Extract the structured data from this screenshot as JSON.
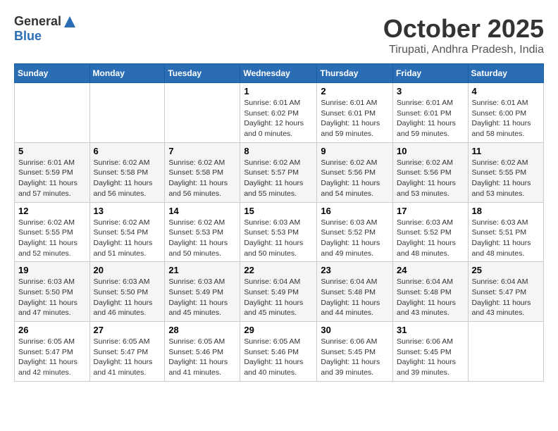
{
  "logo": {
    "general": "General",
    "blue": "Blue"
  },
  "header": {
    "month": "October 2025",
    "location": "Tirupati, Andhra Pradesh, India"
  },
  "weekdays": [
    "Sunday",
    "Monday",
    "Tuesday",
    "Wednesday",
    "Thursday",
    "Friday",
    "Saturday"
  ],
  "weeks": [
    [
      {
        "day": "",
        "info": ""
      },
      {
        "day": "",
        "info": ""
      },
      {
        "day": "",
        "info": ""
      },
      {
        "day": "1",
        "info": "Sunrise: 6:01 AM\nSunset: 6:02 PM\nDaylight: 12 hours\nand 0 minutes."
      },
      {
        "day": "2",
        "info": "Sunrise: 6:01 AM\nSunset: 6:01 PM\nDaylight: 11 hours\nand 59 minutes."
      },
      {
        "day": "3",
        "info": "Sunrise: 6:01 AM\nSunset: 6:01 PM\nDaylight: 11 hours\nand 59 minutes."
      },
      {
        "day": "4",
        "info": "Sunrise: 6:01 AM\nSunset: 6:00 PM\nDaylight: 11 hours\nand 58 minutes."
      }
    ],
    [
      {
        "day": "5",
        "info": "Sunrise: 6:01 AM\nSunset: 5:59 PM\nDaylight: 11 hours\nand 57 minutes."
      },
      {
        "day": "6",
        "info": "Sunrise: 6:02 AM\nSunset: 5:58 PM\nDaylight: 11 hours\nand 56 minutes."
      },
      {
        "day": "7",
        "info": "Sunrise: 6:02 AM\nSunset: 5:58 PM\nDaylight: 11 hours\nand 56 minutes."
      },
      {
        "day": "8",
        "info": "Sunrise: 6:02 AM\nSunset: 5:57 PM\nDaylight: 11 hours\nand 55 minutes."
      },
      {
        "day": "9",
        "info": "Sunrise: 6:02 AM\nSunset: 5:56 PM\nDaylight: 11 hours\nand 54 minutes."
      },
      {
        "day": "10",
        "info": "Sunrise: 6:02 AM\nSunset: 5:56 PM\nDaylight: 11 hours\nand 53 minutes."
      },
      {
        "day": "11",
        "info": "Sunrise: 6:02 AM\nSunset: 5:55 PM\nDaylight: 11 hours\nand 53 minutes."
      }
    ],
    [
      {
        "day": "12",
        "info": "Sunrise: 6:02 AM\nSunset: 5:55 PM\nDaylight: 11 hours\nand 52 minutes."
      },
      {
        "day": "13",
        "info": "Sunrise: 6:02 AM\nSunset: 5:54 PM\nDaylight: 11 hours\nand 51 minutes."
      },
      {
        "day": "14",
        "info": "Sunrise: 6:02 AM\nSunset: 5:53 PM\nDaylight: 11 hours\nand 50 minutes."
      },
      {
        "day": "15",
        "info": "Sunrise: 6:03 AM\nSunset: 5:53 PM\nDaylight: 11 hours\nand 50 minutes."
      },
      {
        "day": "16",
        "info": "Sunrise: 6:03 AM\nSunset: 5:52 PM\nDaylight: 11 hours\nand 49 minutes."
      },
      {
        "day": "17",
        "info": "Sunrise: 6:03 AM\nSunset: 5:52 PM\nDaylight: 11 hours\nand 48 minutes."
      },
      {
        "day": "18",
        "info": "Sunrise: 6:03 AM\nSunset: 5:51 PM\nDaylight: 11 hours\nand 48 minutes."
      }
    ],
    [
      {
        "day": "19",
        "info": "Sunrise: 6:03 AM\nSunset: 5:50 PM\nDaylight: 11 hours\nand 47 minutes."
      },
      {
        "day": "20",
        "info": "Sunrise: 6:03 AM\nSunset: 5:50 PM\nDaylight: 11 hours\nand 46 minutes."
      },
      {
        "day": "21",
        "info": "Sunrise: 6:03 AM\nSunset: 5:49 PM\nDaylight: 11 hours\nand 45 minutes."
      },
      {
        "day": "22",
        "info": "Sunrise: 6:04 AM\nSunset: 5:49 PM\nDaylight: 11 hours\nand 45 minutes."
      },
      {
        "day": "23",
        "info": "Sunrise: 6:04 AM\nSunset: 5:48 PM\nDaylight: 11 hours\nand 44 minutes."
      },
      {
        "day": "24",
        "info": "Sunrise: 6:04 AM\nSunset: 5:48 PM\nDaylight: 11 hours\nand 43 minutes."
      },
      {
        "day": "25",
        "info": "Sunrise: 6:04 AM\nSunset: 5:47 PM\nDaylight: 11 hours\nand 43 minutes."
      }
    ],
    [
      {
        "day": "26",
        "info": "Sunrise: 6:05 AM\nSunset: 5:47 PM\nDaylight: 11 hours\nand 42 minutes."
      },
      {
        "day": "27",
        "info": "Sunrise: 6:05 AM\nSunset: 5:47 PM\nDaylight: 11 hours\nand 41 minutes."
      },
      {
        "day": "28",
        "info": "Sunrise: 6:05 AM\nSunset: 5:46 PM\nDaylight: 11 hours\nand 41 minutes."
      },
      {
        "day": "29",
        "info": "Sunrise: 6:05 AM\nSunset: 5:46 PM\nDaylight: 11 hours\nand 40 minutes."
      },
      {
        "day": "30",
        "info": "Sunrise: 6:06 AM\nSunset: 5:45 PM\nDaylight: 11 hours\nand 39 minutes."
      },
      {
        "day": "31",
        "info": "Sunrise: 6:06 AM\nSunset: 5:45 PM\nDaylight: 11 hours\nand 39 minutes."
      },
      {
        "day": "",
        "info": ""
      }
    ]
  ]
}
